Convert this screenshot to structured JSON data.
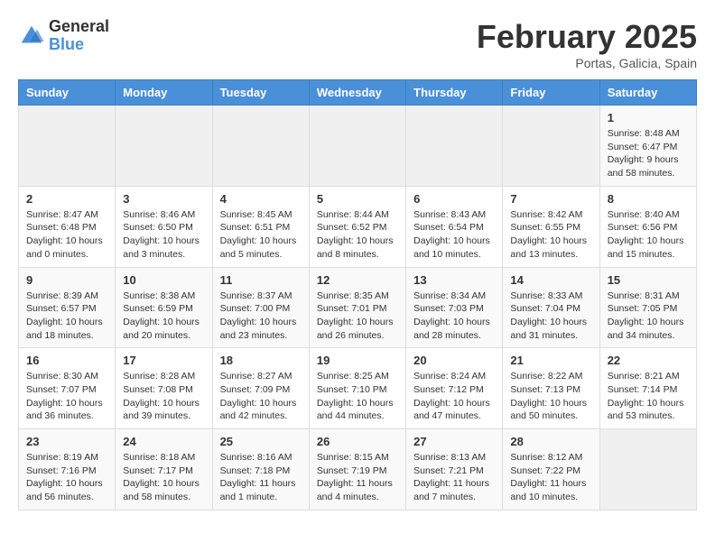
{
  "header": {
    "logo_general": "General",
    "logo_blue": "Blue",
    "title": "February 2025",
    "subtitle": "Portas, Galicia, Spain"
  },
  "days_of_week": [
    "Sunday",
    "Monday",
    "Tuesday",
    "Wednesday",
    "Thursday",
    "Friday",
    "Saturday"
  ],
  "weeks": [
    [
      {
        "day": "",
        "info": ""
      },
      {
        "day": "",
        "info": ""
      },
      {
        "day": "",
        "info": ""
      },
      {
        "day": "",
        "info": ""
      },
      {
        "day": "",
        "info": ""
      },
      {
        "day": "",
        "info": ""
      },
      {
        "day": "1",
        "info": "Sunrise: 8:48 AM\nSunset: 6:47 PM\nDaylight: 9 hours and 58 minutes."
      }
    ],
    [
      {
        "day": "2",
        "info": "Sunrise: 8:47 AM\nSunset: 6:48 PM\nDaylight: 10 hours and 0 minutes."
      },
      {
        "day": "3",
        "info": "Sunrise: 8:46 AM\nSunset: 6:50 PM\nDaylight: 10 hours and 3 minutes."
      },
      {
        "day": "4",
        "info": "Sunrise: 8:45 AM\nSunset: 6:51 PM\nDaylight: 10 hours and 5 minutes."
      },
      {
        "day": "5",
        "info": "Sunrise: 8:44 AM\nSunset: 6:52 PM\nDaylight: 10 hours and 8 minutes."
      },
      {
        "day": "6",
        "info": "Sunrise: 8:43 AM\nSunset: 6:54 PM\nDaylight: 10 hours and 10 minutes."
      },
      {
        "day": "7",
        "info": "Sunrise: 8:42 AM\nSunset: 6:55 PM\nDaylight: 10 hours and 13 minutes."
      },
      {
        "day": "8",
        "info": "Sunrise: 8:40 AM\nSunset: 6:56 PM\nDaylight: 10 hours and 15 minutes."
      }
    ],
    [
      {
        "day": "9",
        "info": "Sunrise: 8:39 AM\nSunset: 6:57 PM\nDaylight: 10 hours and 18 minutes."
      },
      {
        "day": "10",
        "info": "Sunrise: 8:38 AM\nSunset: 6:59 PM\nDaylight: 10 hours and 20 minutes."
      },
      {
        "day": "11",
        "info": "Sunrise: 8:37 AM\nSunset: 7:00 PM\nDaylight: 10 hours and 23 minutes."
      },
      {
        "day": "12",
        "info": "Sunrise: 8:35 AM\nSunset: 7:01 PM\nDaylight: 10 hours and 26 minutes."
      },
      {
        "day": "13",
        "info": "Sunrise: 8:34 AM\nSunset: 7:03 PM\nDaylight: 10 hours and 28 minutes."
      },
      {
        "day": "14",
        "info": "Sunrise: 8:33 AM\nSunset: 7:04 PM\nDaylight: 10 hours and 31 minutes."
      },
      {
        "day": "15",
        "info": "Sunrise: 8:31 AM\nSunset: 7:05 PM\nDaylight: 10 hours and 34 minutes."
      }
    ],
    [
      {
        "day": "16",
        "info": "Sunrise: 8:30 AM\nSunset: 7:07 PM\nDaylight: 10 hours and 36 minutes."
      },
      {
        "day": "17",
        "info": "Sunrise: 8:28 AM\nSunset: 7:08 PM\nDaylight: 10 hours and 39 minutes."
      },
      {
        "day": "18",
        "info": "Sunrise: 8:27 AM\nSunset: 7:09 PM\nDaylight: 10 hours and 42 minutes."
      },
      {
        "day": "19",
        "info": "Sunrise: 8:25 AM\nSunset: 7:10 PM\nDaylight: 10 hours and 44 minutes."
      },
      {
        "day": "20",
        "info": "Sunrise: 8:24 AM\nSunset: 7:12 PM\nDaylight: 10 hours and 47 minutes."
      },
      {
        "day": "21",
        "info": "Sunrise: 8:22 AM\nSunset: 7:13 PM\nDaylight: 10 hours and 50 minutes."
      },
      {
        "day": "22",
        "info": "Sunrise: 8:21 AM\nSunset: 7:14 PM\nDaylight: 10 hours and 53 minutes."
      }
    ],
    [
      {
        "day": "23",
        "info": "Sunrise: 8:19 AM\nSunset: 7:16 PM\nDaylight: 10 hours and 56 minutes."
      },
      {
        "day": "24",
        "info": "Sunrise: 8:18 AM\nSunset: 7:17 PM\nDaylight: 10 hours and 58 minutes."
      },
      {
        "day": "25",
        "info": "Sunrise: 8:16 AM\nSunset: 7:18 PM\nDaylight: 11 hours and 1 minute."
      },
      {
        "day": "26",
        "info": "Sunrise: 8:15 AM\nSunset: 7:19 PM\nDaylight: 11 hours and 4 minutes."
      },
      {
        "day": "27",
        "info": "Sunrise: 8:13 AM\nSunset: 7:21 PM\nDaylight: 11 hours and 7 minutes."
      },
      {
        "day": "28",
        "info": "Sunrise: 8:12 AM\nSunset: 7:22 PM\nDaylight: 11 hours and 10 minutes."
      },
      {
        "day": "",
        "info": ""
      }
    ]
  ]
}
